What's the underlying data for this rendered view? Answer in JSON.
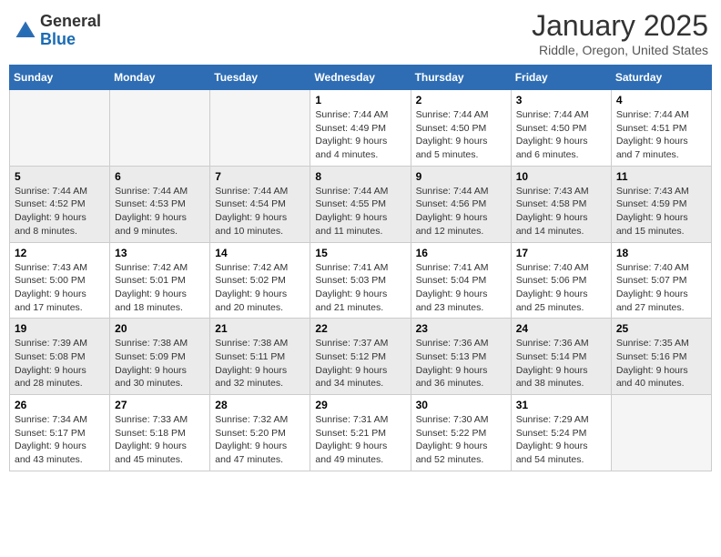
{
  "header": {
    "logo_general": "General",
    "logo_blue": "Blue",
    "month_title": "January 2025",
    "location": "Riddle, Oregon, United States"
  },
  "days_of_week": [
    "Sunday",
    "Monday",
    "Tuesday",
    "Wednesday",
    "Thursday",
    "Friday",
    "Saturday"
  ],
  "weeks": [
    [
      {
        "day": "",
        "info": ""
      },
      {
        "day": "",
        "info": ""
      },
      {
        "day": "",
        "info": ""
      },
      {
        "day": "1",
        "info": "Sunrise: 7:44 AM\nSunset: 4:49 PM\nDaylight: 9 hours and 4 minutes."
      },
      {
        "day": "2",
        "info": "Sunrise: 7:44 AM\nSunset: 4:50 PM\nDaylight: 9 hours and 5 minutes."
      },
      {
        "day": "3",
        "info": "Sunrise: 7:44 AM\nSunset: 4:50 PM\nDaylight: 9 hours and 6 minutes."
      },
      {
        "day": "4",
        "info": "Sunrise: 7:44 AM\nSunset: 4:51 PM\nDaylight: 9 hours and 7 minutes."
      }
    ],
    [
      {
        "day": "5",
        "info": "Sunrise: 7:44 AM\nSunset: 4:52 PM\nDaylight: 9 hours and 8 minutes."
      },
      {
        "day": "6",
        "info": "Sunrise: 7:44 AM\nSunset: 4:53 PM\nDaylight: 9 hours and 9 minutes."
      },
      {
        "day": "7",
        "info": "Sunrise: 7:44 AM\nSunset: 4:54 PM\nDaylight: 9 hours and 10 minutes."
      },
      {
        "day": "8",
        "info": "Sunrise: 7:44 AM\nSunset: 4:55 PM\nDaylight: 9 hours and 11 minutes."
      },
      {
        "day": "9",
        "info": "Sunrise: 7:44 AM\nSunset: 4:56 PM\nDaylight: 9 hours and 12 minutes."
      },
      {
        "day": "10",
        "info": "Sunrise: 7:43 AM\nSunset: 4:58 PM\nDaylight: 9 hours and 14 minutes."
      },
      {
        "day": "11",
        "info": "Sunrise: 7:43 AM\nSunset: 4:59 PM\nDaylight: 9 hours and 15 minutes."
      }
    ],
    [
      {
        "day": "12",
        "info": "Sunrise: 7:43 AM\nSunset: 5:00 PM\nDaylight: 9 hours and 17 minutes."
      },
      {
        "day": "13",
        "info": "Sunrise: 7:42 AM\nSunset: 5:01 PM\nDaylight: 9 hours and 18 minutes."
      },
      {
        "day": "14",
        "info": "Sunrise: 7:42 AM\nSunset: 5:02 PM\nDaylight: 9 hours and 20 minutes."
      },
      {
        "day": "15",
        "info": "Sunrise: 7:41 AM\nSunset: 5:03 PM\nDaylight: 9 hours and 21 minutes."
      },
      {
        "day": "16",
        "info": "Sunrise: 7:41 AM\nSunset: 5:04 PM\nDaylight: 9 hours and 23 minutes."
      },
      {
        "day": "17",
        "info": "Sunrise: 7:40 AM\nSunset: 5:06 PM\nDaylight: 9 hours and 25 minutes."
      },
      {
        "day": "18",
        "info": "Sunrise: 7:40 AM\nSunset: 5:07 PM\nDaylight: 9 hours and 27 minutes."
      }
    ],
    [
      {
        "day": "19",
        "info": "Sunrise: 7:39 AM\nSunset: 5:08 PM\nDaylight: 9 hours and 28 minutes."
      },
      {
        "day": "20",
        "info": "Sunrise: 7:38 AM\nSunset: 5:09 PM\nDaylight: 9 hours and 30 minutes."
      },
      {
        "day": "21",
        "info": "Sunrise: 7:38 AM\nSunset: 5:11 PM\nDaylight: 9 hours and 32 minutes."
      },
      {
        "day": "22",
        "info": "Sunrise: 7:37 AM\nSunset: 5:12 PM\nDaylight: 9 hours and 34 minutes."
      },
      {
        "day": "23",
        "info": "Sunrise: 7:36 AM\nSunset: 5:13 PM\nDaylight: 9 hours and 36 minutes."
      },
      {
        "day": "24",
        "info": "Sunrise: 7:36 AM\nSunset: 5:14 PM\nDaylight: 9 hours and 38 minutes."
      },
      {
        "day": "25",
        "info": "Sunrise: 7:35 AM\nSunset: 5:16 PM\nDaylight: 9 hours and 40 minutes."
      }
    ],
    [
      {
        "day": "26",
        "info": "Sunrise: 7:34 AM\nSunset: 5:17 PM\nDaylight: 9 hours and 43 minutes."
      },
      {
        "day": "27",
        "info": "Sunrise: 7:33 AM\nSunset: 5:18 PM\nDaylight: 9 hours and 45 minutes."
      },
      {
        "day": "28",
        "info": "Sunrise: 7:32 AM\nSunset: 5:20 PM\nDaylight: 9 hours and 47 minutes."
      },
      {
        "day": "29",
        "info": "Sunrise: 7:31 AM\nSunset: 5:21 PM\nDaylight: 9 hours and 49 minutes."
      },
      {
        "day": "30",
        "info": "Sunrise: 7:30 AM\nSunset: 5:22 PM\nDaylight: 9 hours and 52 minutes."
      },
      {
        "day": "31",
        "info": "Sunrise: 7:29 AM\nSunset: 5:24 PM\nDaylight: 9 hours and 54 minutes."
      },
      {
        "day": "",
        "info": ""
      }
    ]
  ]
}
